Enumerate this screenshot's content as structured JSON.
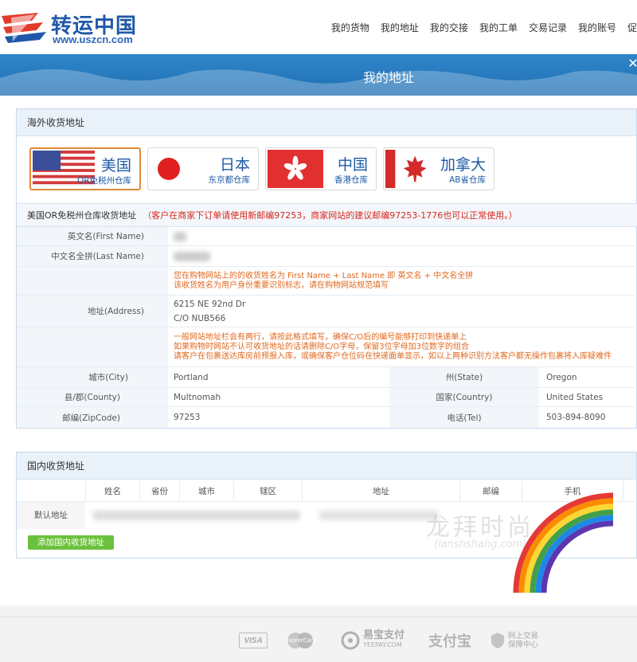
{
  "header": {
    "logo_cn": "转运中国",
    "logo_url": "www.uszcn.com",
    "nav": [
      "我的货物",
      "我的地址",
      "我的交接",
      "我的工单",
      "交易记录",
      "我的账号",
      "促"
    ]
  },
  "banner": {
    "title": "我的地址"
  },
  "overseas": {
    "title": "海外收货地址",
    "warehouses": [
      {
        "name": "美国",
        "sub": "OR免税州仓库",
        "icon": "us-flag-icon"
      },
      {
        "name": "日本",
        "sub": "东京都仓库",
        "icon": "japan-flag-icon"
      },
      {
        "name": "中国",
        "sub": "香港仓库",
        "icon": "hongkong-flag-icon"
      },
      {
        "name": "加拿大",
        "sub": "AB省仓库",
        "icon": "canada-flag-icon"
      }
    ],
    "address_heading": "美国OR免税州仓库收货地址",
    "address_note": "（客户在商家下订单请使用新邮编97253，商家网站的建议邮编97253-1776也可以正常使用。）",
    "fields": {
      "first_name_label": "英文名(First Name)",
      "last_name_label": "中文名全拼(Last Name)",
      "name_tip_1": "您在购物网站上的的收货姓名为 First Name + Last Name 即 英文名 + 中文名全拼",
      "name_tip_2": "该收货姓名为用户身份重要识别标志，请在购物网站规范填写",
      "address_label": "地址(Address)",
      "address_line1": "6215 NE 92nd Dr",
      "address_line2": "C/O NUB566",
      "addr_tip_1": "一般网站地址栏会有两行，请按此格式填写，确保C/O后的编号能够打印到快递单上",
      "addr_tip_2": "如果购物时网站不认可收货地址的话请删除C/O字母，保留3位字母加3位数字的组合",
      "addr_tip_3": "请客户在包裹送达库房前预报入库，或确保客户仓位码在快递面单显示，如以上两种识别方法客户都无操作包裹将入库疑难件",
      "city_label": "城市(City)",
      "city": "Portland",
      "state_label": "州(State)",
      "state": "Oregon",
      "county_label": "县/郡(County)",
      "county": "Multnomah",
      "country_label": "国家(Country)",
      "country": "United States",
      "zip_label": "邮编(ZipCode)",
      "zip": "97253",
      "tel_label": "电话(Tel)",
      "tel": "503-894-8090"
    }
  },
  "domestic": {
    "title": "国内收货地址",
    "columns": [
      "姓名",
      "省份",
      "城市",
      "辖区",
      "地址",
      "邮编",
      "手机"
    ],
    "row_label": "默认地址",
    "add_button": "添加国内收货地址"
  },
  "watermark": {
    "main": "龙拜时尚",
    "sub": "(lanshshang.com)"
  },
  "footer": {
    "visa": "VISA",
    "mastercard": "MasterCard",
    "yeepay": "易宝支付",
    "yeepay_sub": "YEEPAY.COM",
    "alipay": "支付宝",
    "trust_1": "网上交易",
    "trust_2": "保障中心"
  },
  "colors": {
    "brand_blue": "#1f58a8",
    "banner_blue": "#2a7dc1",
    "accent_red": "#d9281f",
    "tip_orange": "#e0691f",
    "add_green": "#6cc13c"
  }
}
